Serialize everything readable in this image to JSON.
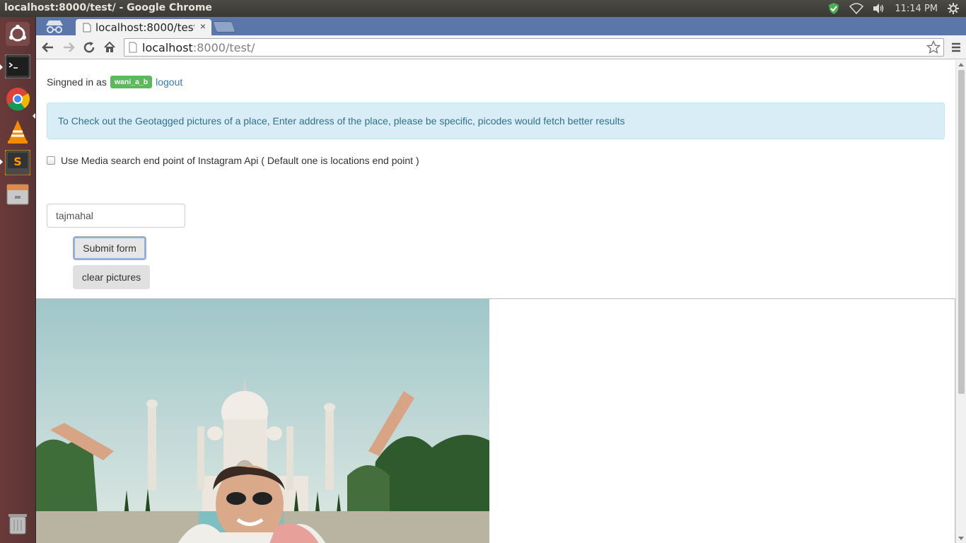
{
  "os_panel": {
    "window_title": "localhost:8000/test/ - Google Chrome",
    "clock": "11:14 PM"
  },
  "launcher": {
    "items": [
      "ubuntu-dash-icon",
      "terminal-icon",
      "chrome-icon",
      "vlc-icon",
      "sublime-text-icon",
      "files-icon",
      "trash-icon"
    ]
  },
  "browser": {
    "tab_title": "localhost:8000/test/",
    "tab_close": "×",
    "url_host": "localhost",
    "url_rest": ":8000/test/"
  },
  "page": {
    "signed_in_prefix": "Singned in as",
    "username": "wani_a_b",
    "logout_label": "logout",
    "info_message": "To Check out the Geotagged pictures of a place, Enter address of the place, please be specific, picodes would fetch better results",
    "checkbox_label": "Use Media search end point of Instagram Api ( Default one is locations end point )",
    "address_value": "tajmahal",
    "submit_label": "Submit form",
    "clear_label": "clear pictures"
  },
  "colors": {
    "badge": "#5cb85c",
    "alert_bg": "#d9edf7",
    "alert_text": "#31708f",
    "link": "#337ab7"
  }
}
